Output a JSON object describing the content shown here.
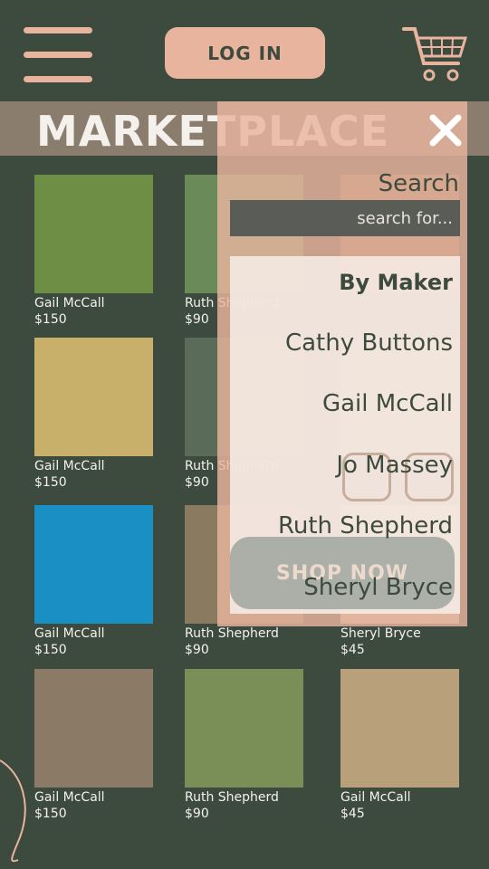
{
  "header": {
    "login_label": "LOG IN"
  },
  "page": {
    "title": "MARKETPLACE"
  },
  "products": [
    {
      "maker": "Gail McCall",
      "price": "$150",
      "color": "#6f8e45"
    },
    {
      "maker": "Ruth Shepherd",
      "price": "$90",
      "color": "#6b8a5a"
    },
    {
      "maker": "",
      "price": "",
      "color": "#8a6a55"
    },
    {
      "maker": "Gail McCall",
      "price": "$150",
      "color": "#c9b06a"
    },
    {
      "maker": "Ruth Shepherd",
      "price": "$90",
      "color": "#5a6b5a"
    },
    {
      "maker": "",
      "price": "",
      "color": "#a08a70"
    },
    {
      "maker": "Gail McCall",
      "price": "$150",
      "color": "#1a8fc4"
    },
    {
      "maker": "Ruth Shepherd",
      "price": "$90",
      "color": "#8a7a60"
    },
    {
      "maker": "Sheryl Bryce",
      "price": "$45",
      "color": "#c8b8a0"
    },
    {
      "maker": "Gail McCall",
      "price": "$150",
      "color": "#8a7a66"
    },
    {
      "maker": "Ruth Shepherd",
      "price": "$90",
      "color": "#7a8e58"
    },
    {
      "maker": "Gail McCall",
      "price": "$45",
      "color": "#b8a07a"
    }
  ],
  "overlay": {
    "search_label": "Search",
    "search_placeholder": "search for...",
    "by_maker_label": "By Maker",
    "makers": [
      "Cathy Buttons",
      "Gail McCall",
      "Jo Massey",
      "Ruth Shepherd",
      "Sheryl Bryce"
    ],
    "shop_now_label": "SHOP NOW"
  },
  "colors": {
    "background": "#3d4a3e",
    "accent": "#e8b49e",
    "band": "#8a7d6e"
  }
}
